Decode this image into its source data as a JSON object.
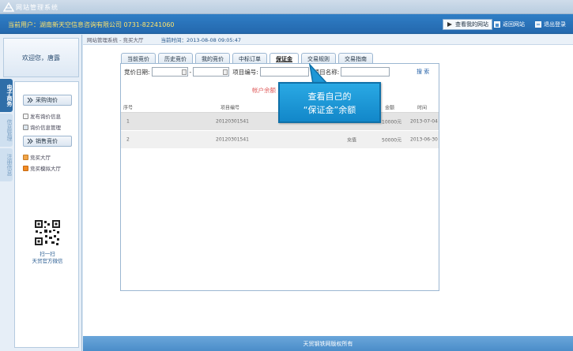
{
  "app": {
    "title": "网站管理系统"
  },
  "userbar": {
    "user_text": "当前用户：湖南新天空信息咨询有限公司 0731-82241060",
    "buttons": [
      {
        "label": "查看我的网站",
        "icon": "arrow-icon"
      },
      {
        "label": "返回网站",
        "icon": "home-icon"
      },
      {
        "label": "退出登录",
        "icon": "exit-icon"
      }
    ]
  },
  "sidebar": {
    "welcome": "欢迎您，唐露",
    "vertical_tabs": [
      "电子商务",
      "信息管理",
      "注册信息"
    ],
    "sections": [
      {
        "header": "采购询价",
        "items": [
          "发布询价信息",
          "询价信息管理"
        ]
      },
      {
        "header": "销售竞价",
        "items": [
          "竞买大厅",
          "竞买模拟大厅"
        ]
      }
    ],
    "qr_caption_1": "扫一扫",
    "qr_caption_2": "天贸官方微信"
  },
  "main": {
    "breadcrumb": "网站管理系统 - 竞买大厅",
    "time": "当前时间：2013-08-08 09:05:47",
    "tabs": [
      "当前竞价",
      "历史竞价",
      "我的竞价",
      "中标订单",
      "保证金",
      "交易规则",
      "交易指南"
    ],
    "active_tab": "保证金",
    "filter": {
      "date_label": "竞价日期:",
      "dash": "-",
      "project_no_label": "项目编号:",
      "project_name_label": "项目名称:",
      "search_label": "搜 索"
    },
    "balance_label": "帐户余额",
    "table": {
      "headers": [
        "序号",
        "项目编号",
        "",
        "金额",
        "时间"
      ],
      "rows": [
        {
          "no": "1",
          "project": "20120301541",
          "type": "",
          "amount": "10000元",
          "time": "2013-07-04"
        },
        {
          "no": "2",
          "project": "20120301541",
          "type": "充值",
          "amount": "50000元",
          "time": "2013-06-30"
        }
      ]
    }
  },
  "callout": {
    "line1": "查看自己的",
    "line2": "“保证金”余额"
  },
  "footer": {
    "text": "天贸钢铁网版权所有"
  }
}
